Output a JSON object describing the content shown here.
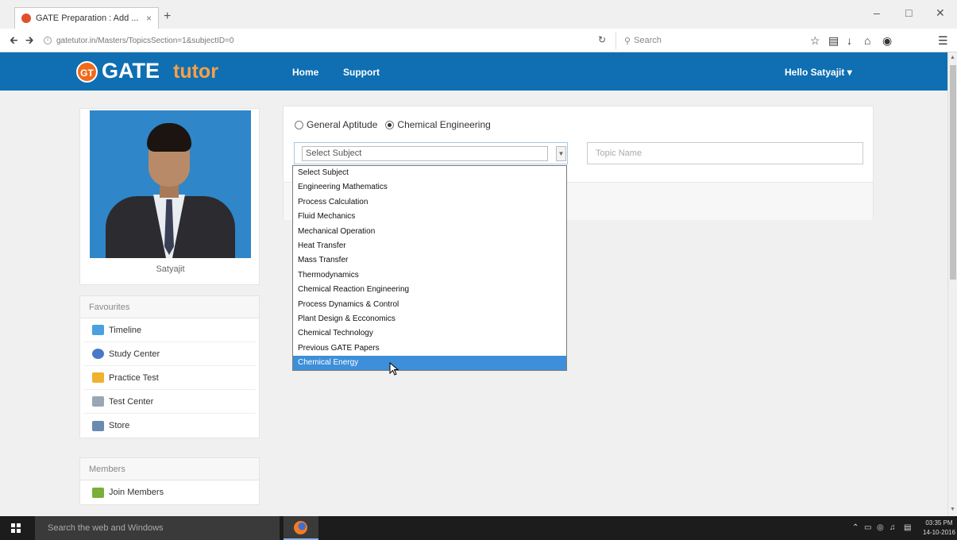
{
  "browser": {
    "tab_title": "GATE Preparation : Add ...",
    "tab_close": "×",
    "new_tab": "+",
    "url": "gatetutor.in/Masters/TopicsSection=1&subjectID=0",
    "search_placeholder": "Search"
  },
  "header": {
    "logo_badge": "GT",
    "logo_gate": "GATE",
    "logo_tutor": "tutor",
    "nav": [
      "Home",
      "Support"
    ],
    "user_menu": "Hello Satyajit ▾"
  },
  "profile": {
    "name": "Satyajit"
  },
  "favourites": {
    "heading": "Favourites",
    "items": [
      {
        "label": "Timeline",
        "icon": "timeline-icon",
        "color": "#4aa0e0"
      },
      {
        "label": "Study Center",
        "icon": "study-center-icon",
        "color": "#4a78c8"
      },
      {
        "label": "Practice Test",
        "icon": "practice-test-icon",
        "color": "#f0b030"
      },
      {
        "label": "Test Center",
        "icon": "test-center-icon",
        "color": "#9aa6b4"
      },
      {
        "label": "Store",
        "icon": "store-icon",
        "color": "#6a8ab0"
      }
    ]
  },
  "members": {
    "heading": "Members",
    "items": [
      {
        "label": "Join Members",
        "icon": "join-members-icon",
        "color": "#7cae3a"
      }
    ]
  },
  "form": {
    "radio_general": "General Aptitude",
    "radio_chemical": "Chemical Engineering",
    "selected_radio": "Chemical Engineering",
    "subject_select_value": "Select Subject",
    "topic_placeholder": "Topic Name"
  },
  "subject_options": [
    "Select Subject",
    "Engineering Mathematics",
    "Process Calculation",
    "Fluid Mechanics",
    "Mechanical Operation",
    "Heat Transfer",
    "Mass Transfer",
    "Thermodynamics",
    "Chemical Reaction Engineering",
    "Process Dynamics & Control",
    "Plant Design & Ecconomics",
    "Chemical Technology",
    "Previous GATE Papers",
    "Chemical Energy"
  ],
  "highlighted_option": "Chemical Energy",
  "taskbar": {
    "search_placeholder": "Search the web and Windows",
    "time": "03:35 PM",
    "date": "14-10-2016"
  },
  "colors": {
    "header_blue": "#0f6fb2",
    "logo_orange": "#f06a1c",
    "highlight": "#3d8fd9"
  }
}
